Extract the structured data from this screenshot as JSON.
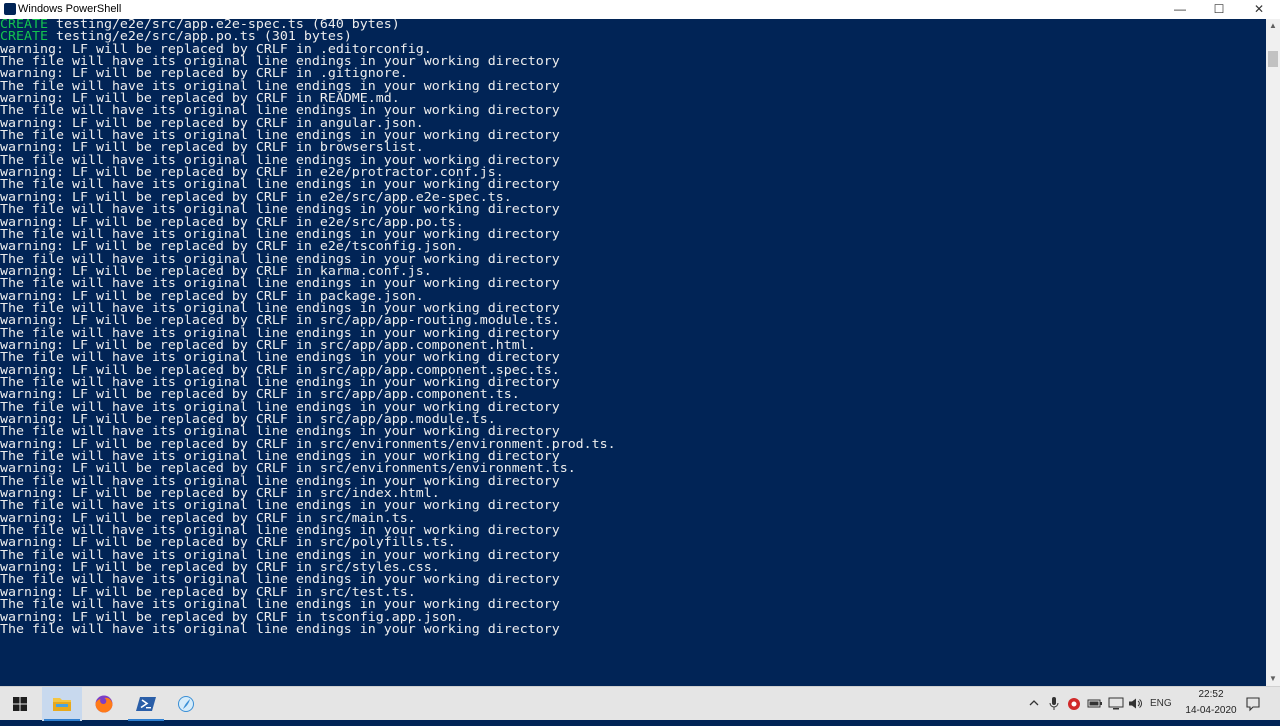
{
  "window": {
    "title": "Windows PowerShell",
    "controls": {
      "minimize": "—",
      "maximize": "☐",
      "close": "✕"
    }
  },
  "console": {
    "lines": [
      {
        "kind": "create",
        "tag": "CREATE",
        "text": " testing/e2e/src/app.e2e-spec.ts (640 bytes)"
      },
      {
        "kind": "create",
        "tag": "CREATE",
        "text": " testing/e2e/src/app.po.ts (301 bytes)"
      },
      {
        "kind": "text",
        "text": "warning: LF will be replaced by CRLF in .editorconfig."
      },
      {
        "kind": "text",
        "text": "The file will have its original line endings in your working directory"
      },
      {
        "kind": "text",
        "text": "warning: LF will be replaced by CRLF in .gitignore."
      },
      {
        "kind": "text",
        "text": "The file will have its original line endings in your working directory"
      },
      {
        "kind": "text",
        "text": "warning: LF will be replaced by CRLF in README.md."
      },
      {
        "kind": "text",
        "text": "The file will have its original line endings in your working directory"
      },
      {
        "kind": "text",
        "text": "warning: LF will be replaced by CRLF in angular.json."
      },
      {
        "kind": "text",
        "text": "The file will have its original line endings in your working directory"
      },
      {
        "kind": "text",
        "text": "warning: LF will be replaced by CRLF in browserslist."
      },
      {
        "kind": "text",
        "text": "The file will have its original line endings in your working directory"
      },
      {
        "kind": "text",
        "text": "warning: LF will be replaced by CRLF in e2e/protractor.conf.js."
      },
      {
        "kind": "text",
        "text": "The file will have its original line endings in your working directory"
      },
      {
        "kind": "text",
        "text": "warning: LF will be replaced by CRLF in e2e/src/app.e2e-spec.ts."
      },
      {
        "kind": "text",
        "text": "The file will have its original line endings in your working directory"
      },
      {
        "kind": "text",
        "text": "warning: LF will be replaced by CRLF in e2e/src/app.po.ts."
      },
      {
        "kind": "text",
        "text": "The file will have its original line endings in your working directory"
      },
      {
        "kind": "text",
        "text": "warning: LF will be replaced by CRLF in e2e/tsconfig.json."
      },
      {
        "kind": "text",
        "text": "The file will have its original line endings in your working directory"
      },
      {
        "kind": "text",
        "text": "warning: LF will be replaced by CRLF in karma.conf.js."
      },
      {
        "kind": "text",
        "text": "The file will have its original line endings in your working directory"
      },
      {
        "kind": "text",
        "text": "warning: LF will be replaced by CRLF in package.json."
      },
      {
        "kind": "text",
        "text": "The file will have its original line endings in your working directory"
      },
      {
        "kind": "text",
        "text": "warning: LF will be replaced by CRLF in src/app/app-routing.module.ts."
      },
      {
        "kind": "text",
        "text": "The file will have its original line endings in your working directory"
      },
      {
        "kind": "text",
        "text": "warning: LF will be replaced by CRLF in src/app/app.component.html."
      },
      {
        "kind": "text",
        "text": "The file will have its original line endings in your working directory"
      },
      {
        "kind": "text",
        "text": "warning: LF will be replaced by CRLF in src/app/app.component.spec.ts."
      },
      {
        "kind": "text",
        "text": "The file will have its original line endings in your working directory"
      },
      {
        "kind": "text",
        "text": "warning: LF will be replaced by CRLF in src/app/app.component.ts."
      },
      {
        "kind": "text",
        "text": "The file will have its original line endings in your working directory"
      },
      {
        "kind": "text",
        "text": "warning: LF will be replaced by CRLF in src/app/app.module.ts."
      },
      {
        "kind": "text",
        "text": "The file will have its original line endings in your working directory"
      },
      {
        "kind": "text",
        "text": "warning: LF will be replaced by CRLF in src/environments/environment.prod.ts."
      },
      {
        "kind": "text",
        "text": "The file will have its original line endings in your working directory"
      },
      {
        "kind": "text",
        "text": "warning: LF will be replaced by CRLF in src/environments/environment.ts."
      },
      {
        "kind": "text",
        "text": "The file will have its original line endings in your working directory"
      },
      {
        "kind": "text",
        "text": "warning: LF will be replaced by CRLF in src/index.html."
      },
      {
        "kind": "text",
        "text": "The file will have its original line endings in your working directory"
      },
      {
        "kind": "text",
        "text": "warning: LF will be replaced by CRLF in src/main.ts."
      },
      {
        "kind": "text",
        "text": "The file will have its original line endings in your working directory"
      },
      {
        "kind": "text",
        "text": "warning: LF will be replaced by CRLF in src/polyfills.ts."
      },
      {
        "kind": "text",
        "text": "The file will have its original line endings in your working directory"
      },
      {
        "kind": "text",
        "text": "warning: LF will be replaced by CRLF in src/styles.css."
      },
      {
        "kind": "text",
        "text": "The file will have its original line endings in your working directory"
      },
      {
        "kind": "text",
        "text": "warning: LF will be replaced by CRLF in src/test.ts."
      },
      {
        "kind": "text",
        "text": "The file will have its original line endings in your working directory"
      },
      {
        "kind": "text",
        "text": "warning: LF will be replaced by CRLF in tsconfig.app.json."
      },
      {
        "kind": "text",
        "text": "The file will have its original line endings in your working directory"
      }
    ]
  },
  "scrollbar": {
    "up_arrow": "▲",
    "down_arrow": "▼"
  },
  "taskbar": {
    "apps": [
      {
        "name": "start-button",
        "icon": "windows-logo-icon",
        "active": false
      },
      {
        "name": "explorer-button",
        "icon": "folder-icon",
        "active": true
      },
      {
        "name": "firefox-button",
        "icon": "firefox-icon",
        "active": false
      },
      {
        "name": "powershell-button",
        "icon": "powershell-icon",
        "active": true
      },
      {
        "name": "app4-button",
        "icon": "feather-app-icon",
        "active": false
      }
    ],
    "tray": {
      "icons": [
        "chevron-up-icon",
        "microphone-icon",
        "antivirus-icon",
        "battery-icon",
        "network-icon",
        "speaker-icon"
      ],
      "language": "ENG",
      "time": "22:52",
      "date": "14-04-2020"
    }
  },
  "colors": {
    "console_bg": "#012456",
    "console_fg": "#eeeeee",
    "create_fg": "#13c44f"
  }
}
